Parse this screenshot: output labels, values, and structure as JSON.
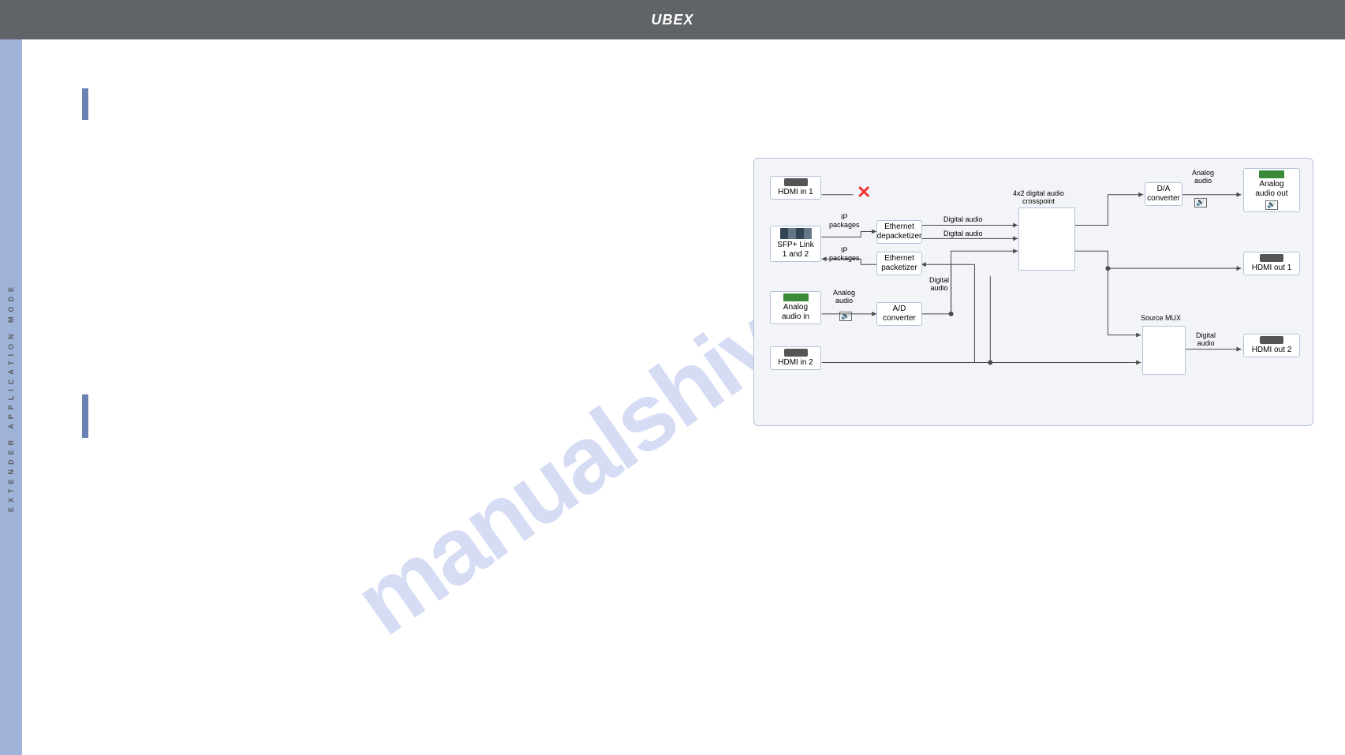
{
  "header": {
    "title": "UBEX"
  },
  "sidebar": {
    "vertical_text": "EXTENDER  APPLICATION  MODE"
  },
  "watermark": "manualshive.com",
  "diagram": {
    "hdmi_in_1": "HDMI in 1",
    "hdmi_in_2": "HDMI in 2",
    "sfp_link": "SFP+ Link\n1 and 2",
    "analog_audio_in": "Analog\naudio in",
    "analog_audio_out": "Analog\naudio out",
    "hdmi_out_1": "HDMI out 1",
    "hdmi_out_2": "HDMI out 2",
    "eth_depacketizer": "Ethernet\ndepacketizer",
    "eth_packetizer": "Ethernet\npacketizer",
    "ad_converter": "A/D\nconverter",
    "da_converter": "D/A\nconverter",
    "ip_packages_u": "IP\npackages",
    "ip_packages_l": "IP\npackages",
    "analog_audio_lbl": "Analog\naudio",
    "analog_audio_lbl2": "Analog\naudio",
    "digital_audio_1": "Digital audio",
    "digital_audio_2": "Digital audio",
    "digital_audio_v": "Digital\naudio",
    "digital_audio_r1": "Digital\naudio",
    "crosspoint_title": "4x2 digital audio\ncrosspoint",
    "source_mux": "Source MUX"
  }
}
